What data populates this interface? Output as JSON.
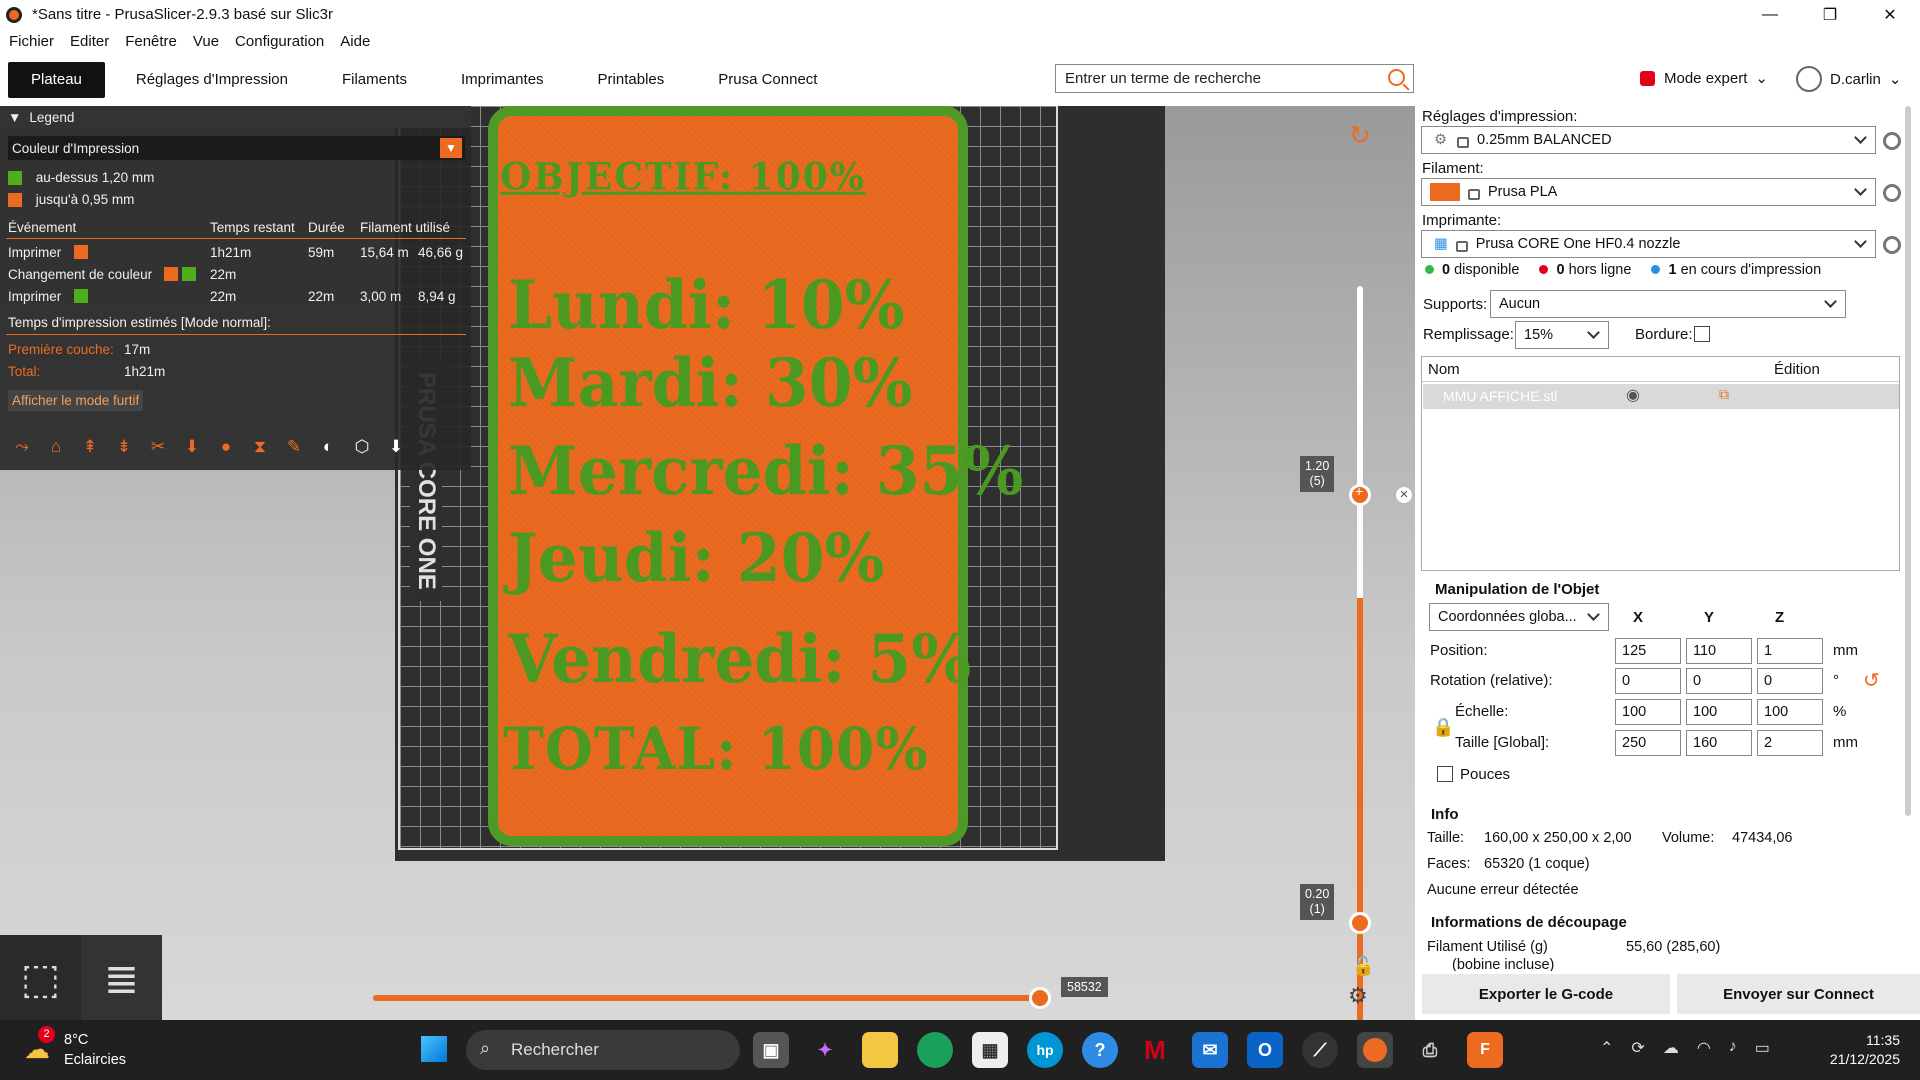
{
  "window": {
    "title": "*Sans titre - PrusaSlicer-2.9.3 basé sur Slic3r",
    "minimize": "—",
    "maximize": "❐",
    "close": "✕"
  },
  "menu": [
    "Fichier",
    "Editer",
    "Fenêtre",
    "Vue",
    "Configuration",
    "Aide"
  ],
  "tabs": [
    "Plateau",
    "Réglages d'Impression",
    "Filaments",
    "Imprimantes",
    "Printables",
    "Prusa Connect"
  ],
  "search": {
    "placeholder": "Entrer un terme de recherche"
  },
  "mode": "Mode expert",
  "user": "D.carlin",
  "legend": {
    "title": "Legend",
    "view_type": "Couleur d'Impression",
    "ranges": [
      {
        "label": "au-dessus 1,20 mm",
        "color": "#4caf1b"
      },
      {
        "label": "jusqu'à 0,95 mm",
        "color": "#ed6b21"
      }
    ],
    "columns": [
      "Événement",
      "Temps restant",
      "Durée",
      "Filament utilisé"
    ],
    "events": [
      {
        "name": "Imprimer",
        "remaining": "1h21m",
        "duration": "59m",
        "length": "15,64 m",
        "weight": "46,66 g"
      },
      {
        "name": "Changement de couleur",
        "remaining": "22m",
        "duration": "",
        "length": "",
        "weight": ""
      },
      {
        "name": "Imprimer",
        "remaining": "22m",
        "duration": "22m",
        "length": "3,00 m",
        "weight": "8,94 g"
      }
    ],
    "estimate_title": "Temps d'impression estimés [Mode normal]:",
    "first_layer_label": "Première couche:",
    "first_layer": "17m",
    "total_label": "Total:",
    "total": "1h21m",
    "stealth_button": "Afficher le mode furtif"
  },
  "model": {
    "lines": [
      "OBJECTIF: 100%",
      "Lundi: 10%",
      "Mardi: 30%",
      "Mercredi: 35%",
      "Jeudi: 20%",
      "Vendredi: 5%",
      "TOTAL: 100%"
    ],
    "plate_color": "#ed6b21",
    "text_color": "#4caf1b"
  },
  "bed_brand": "PRUSA CORE ONE",
  "slider": {
    "top_label": "1.20\n(5)",
    "bottom_label": "0.20\n(1)",
    "move_value": "58532"
  },
  "right": {
    "print_label": "Réglages d'impression:",
    "print_value": "0.25mm BALANCED",
    "filament_label": "Filament:",
    "filament_value": "Prusa PLA",
    "printer_label": "Imprimante:",
    "printer_value": "Prusa CORE One HF0.4 nozzle",
    "status": [
      {
        "count": "0",
        "text": "disponible",
        "color": "#39b54a"
      },
      {
        "count": "0",
        "text": "hors ligne",
        "color": "#e2001a"
      },
      {
        "count": "1",
        "text": "en cours d'impression",
        "color": "#2d8fe0"
      }
    ],
    "supports_label": "Supports:",
    "supports_value": "Aucun",
    "infill_label": "Remplissage:",
    "infill_value": "15%",
    "brim_label": "Bordure:",
    "list_col_name": "Nom",
    "list_col_edit": "Édition",
    "object_name": "MMU AFFICHE.stl",
    "manip_title": "Manipulation de l'Objet",
    "coords": "Coordonnées globa...",
    "axes": [
      "X",
      "Y",
      "Z"
    ],
    "position_label": "Position:",
    "position": [
      "125",
      "110",
      "1"
    ],
    "position_unit": "mm",
    "rotation_label": "Rotation (relative):",
    "rotation": [
      "0",
      "0",
      "0"
    ],
    "rotation_unit": "°",
    "scale_label": "Échelle:",
    "scale": [
      "100",
      "100",
      "100"
    ],
    "scale_unit": "%",
    "size_label": "Taille [Global]:",
    "size": [
      "250",
      "160",
      "2"
    ],
    "size_unit": "mm",
    "inches_label": "Pouces",
    "info_title": "Info",
    "size_info_label": "Taille:",
    "size_info": "160,00 x 250,00 x 2,00",
    "volume_label": "Volume:",
    "volume": "47434,06",
    "faces_label": "Faces:",
    "faces": "65320 (1 coque)",
    "errors": "Aucune erreur détectée",
    "slice_title": "Informations de découpage",
    "filament_used_label": "Filament Utilisé (g)",
    "filament_used": "55,60 (285,60)",
    "spool_label": "(bobine incluse)",
    "export_button": "Exporter le G-code",
    "send_button": "Envoyer sur Connect"
  },
  "taskbar": {
    "temp": "8°C",
    "weather": "Eclaircies",
    "weather_badge": "2",
    "search": "Rechercher",
    "time": "11:35",
    "date": "21/12/2025"
  }
}
